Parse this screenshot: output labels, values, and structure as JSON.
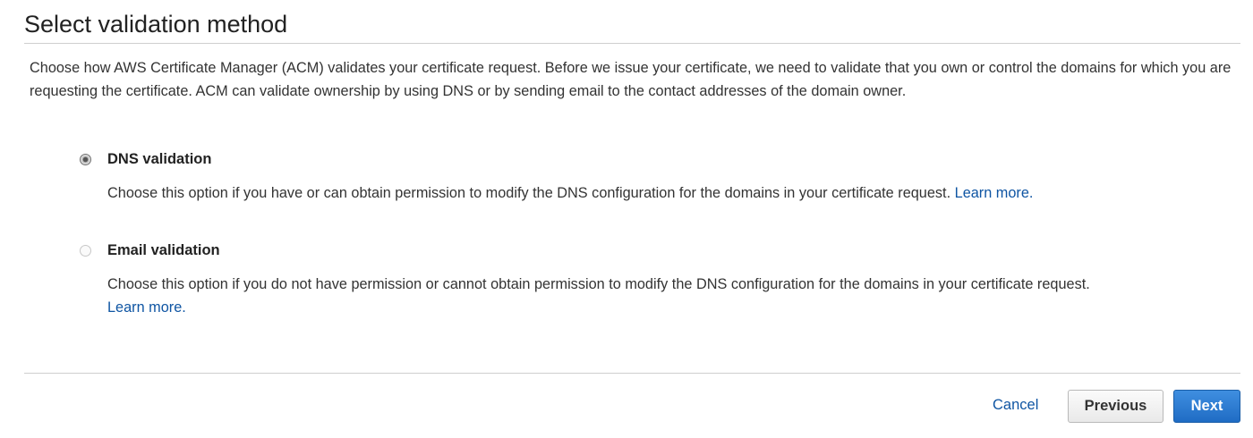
{
  "page": {
    "title": "Select validation method",
    "intro": "Choose how AWS Certificate Manager (ACM) validates your certificate request. Before we issue your certificate, we need to validate that you own or control the domains for which you are requesting the certificate. ACM can validate ownership by using DNS or by sending email to the contact addresses of the domain owner."
  },
  "options": [
    {
      "label": "DNS validation",
      "selected": true,
      "description": "Choose this option if you have or can obtain permission to modify the DNS configuration for the domains in your certificate request.",
      "link_text": "Learn more."
    },
    {
      "label": "Email validation",
      "selected": false,
      "description": "Choose this option if you do not have permission or cannot obtain permission to modify the DNS configuration for the domains in your certificate request.",
      "link_text": "Learn more."
    }
  ],
  "footer": {
    "cancel_label": "Cancel",
    "previous_label": "Previous",
    "next_label": "Next"
  },
  "colors": {
    "link": "#0f55a3",
    "primary_button": "#2a77d0",
    "text": "#333333",
    "rule": "#cfcfcf"
  }
}
